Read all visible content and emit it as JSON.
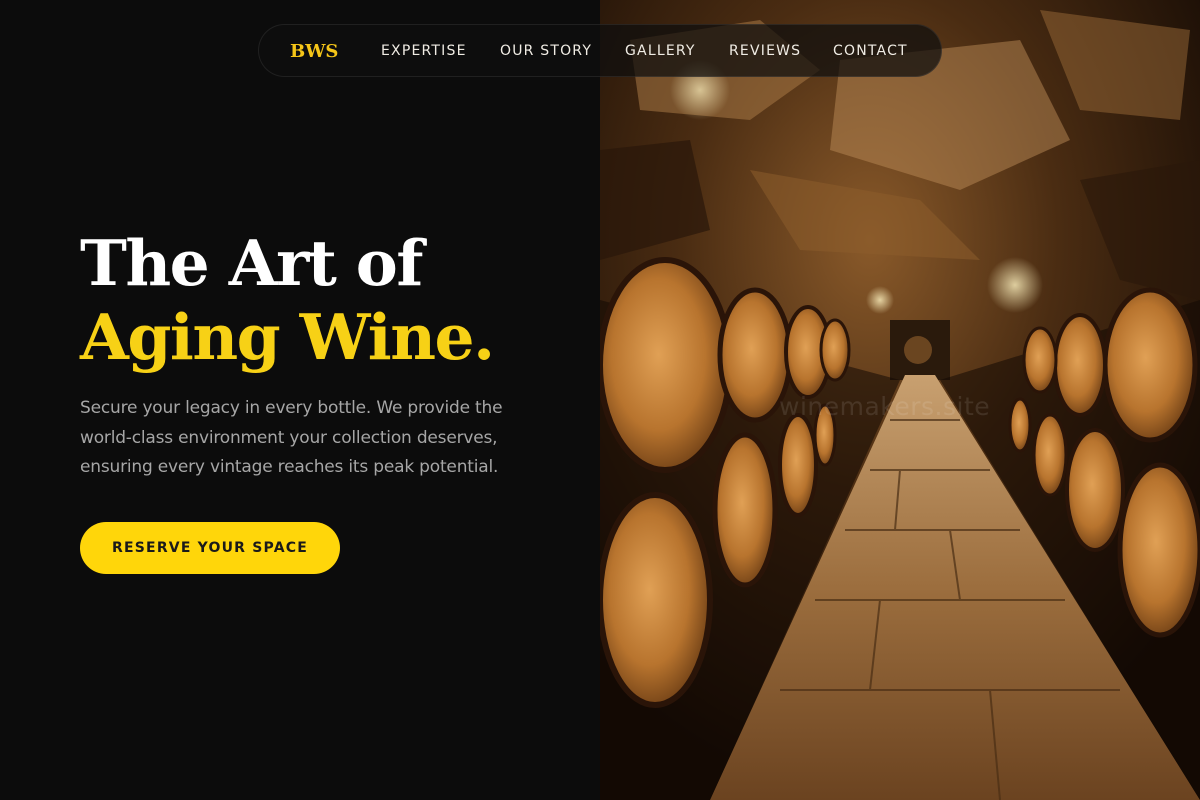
{
  "brand": {
    "logo": "BWS"
  },
  "nav": {
    "items": [
      {
        "label": "EXPERTISE"
      },
      {
        "label": "OUR STORY"
      },
      {
        "label": "GALLERY"
      },
      {
        "label": "REVIEWS"
      },
      {
        "label": "CONTACT"
      }
    ]
  },
  "hero": {
    "headline_line1": "The Art of",
    "headline_line2": "Aging Wine.",
    "subtext": "Secure your legacy in every bottle. We provide the world-class environment your collection deserves, ensuring every vintage reaches its peak potential.",
    "cta_label": "RESERVE YOUR SPACE",
    "image_watermark": "winemakers.site"
  },
  "colors": {
    "background": "#0c0c0c",
    "accent": "#f7d116",
    "button": "#ffd60a",
    "text_primary": "#ffffff",
    "text_muted": "#a6a6a6"
  },
  "image_subject": "wine-cellar-barrels-photo"
}
